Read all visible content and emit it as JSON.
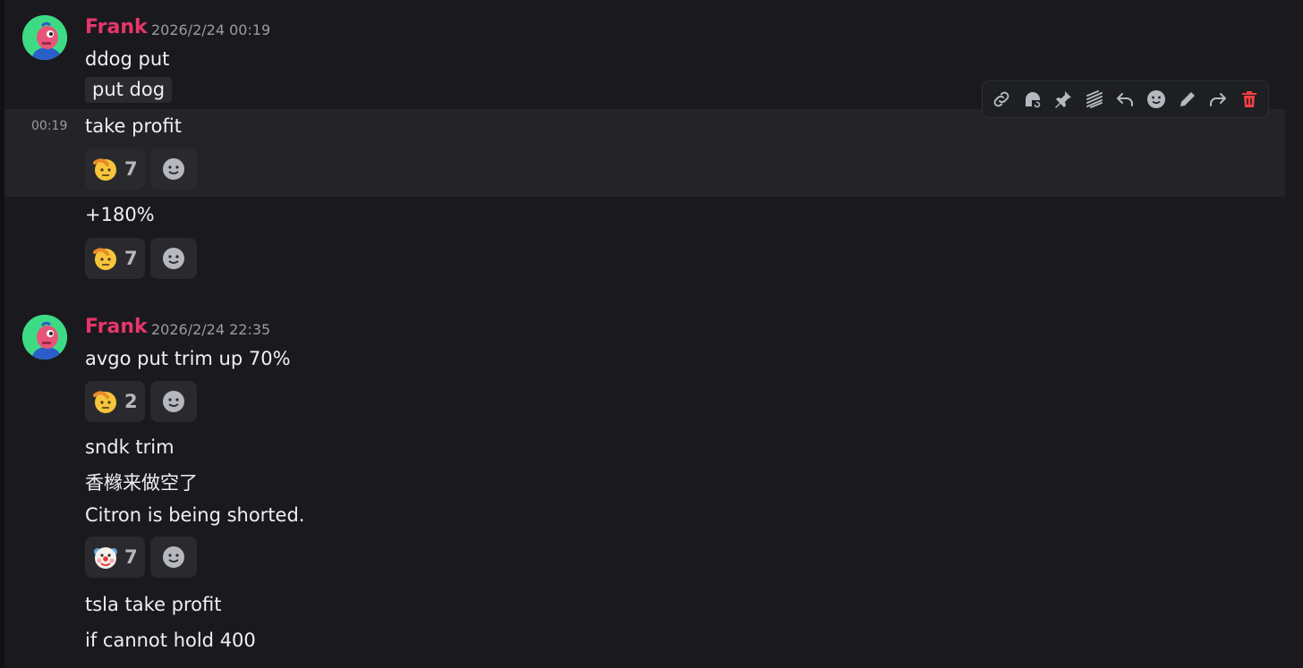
{
  "messages": [
    {
      "author": "Frank",
      "timestamp": "2026/2/24 00:19",
      "lines": [
        "ddog put"
      ],
      "code": "put dog",
      "followups": [
        {
          "side_time": "00:19",
          "text": "take profit",
          "reactions": [
            {
              "emoji": "saluting-face",
              "count": "7"
            }
          ]
        },
        {
          "text": "+180%",
          "reactions": [
            {
              "emoji": "saluting-face",
              "count": "7"
            }
          ]
        }
      ]
    },
    {
      "author": "Frank",
      "timestamp": "2026/2/24 22:35",
      "lines": [
        "avgo put trim up 70%"
      ],
      "reactions": [
        {
          "emoji": "saluting-face",
          "count": "2"
        }
      ],
      "followups": [
        {
          "text": "sndk trim"
        },
        {
          "text": "香橼来做空了"
        },
        {
          "text": "Citron is being shorted.",
          "reactions": [
            {
              "emoji": "clown-face",
              "count": "7"
            }
          ]
        },
        {
          "text": "tsla take profit"
        },
        {
          "text": "if cannot hold 400"
        }
      ]
    }
  ],
  "toolbar": [
    "link-icon",
    "thread-icon",
    "pin-icon",
    "apps-icon",
    "reply-icon",
    "add-reaction-icon",
    "edit-icon",
    "forward-icon",
    "delete-icon"
  ],
  "colors": {
    "background": "#1a1a1e",
    "username": "#e8366b",
    "hover": "#242428",
    "delete": "#f23f43"
  }
}
